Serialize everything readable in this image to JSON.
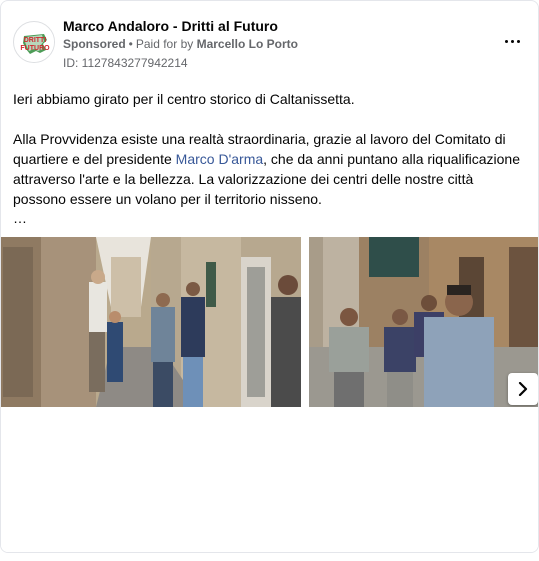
{
  "post": {
    "page_name": "Marco Andaloro - Dritti al Futuro",
    "sponsored_label": "Sponsored",
    "separator": "•",
    "paid_prefix": "Paid for by",
    "paid_by": "Marcello Lo Porto",
    "ad_id": "ID: 1127843277942214",
    "avatar_logo_text_1": "DRITTI",
    "avatar_logo_text_2": "FUTURO",
    "paragraph_1": "Ieri abbiamo girato per il centro storico di Caltanissetta.",
    "paragraph_2_before": "Alla Provvidenza esiste una realtà straordinaria, grazie al lavoro del Comitato di quartiere e del presidente ",
    "mention": "Marco D'arma",
    "paragraph_2_after": ", che da anni puntano alla riqualificazione attraverso l'arte e la bellezza. La valorizzazione dei centri delle nostre città possono essere un volano per il territorio nisseno.",
    "ellipsis": "…"
  },
  "icons": {
    "more": "more-options-icon",
    "next": "chevron-right-icon"
  },
  "colors": {
    "text_primary": "#050505",
    "text_secondary": "#65676b",
    "link": "#385898",
    "border": "#e4e6eb",
    "logo_red": "#d0282e",
    "logo_green": "#2e8b3a"
  }
}
